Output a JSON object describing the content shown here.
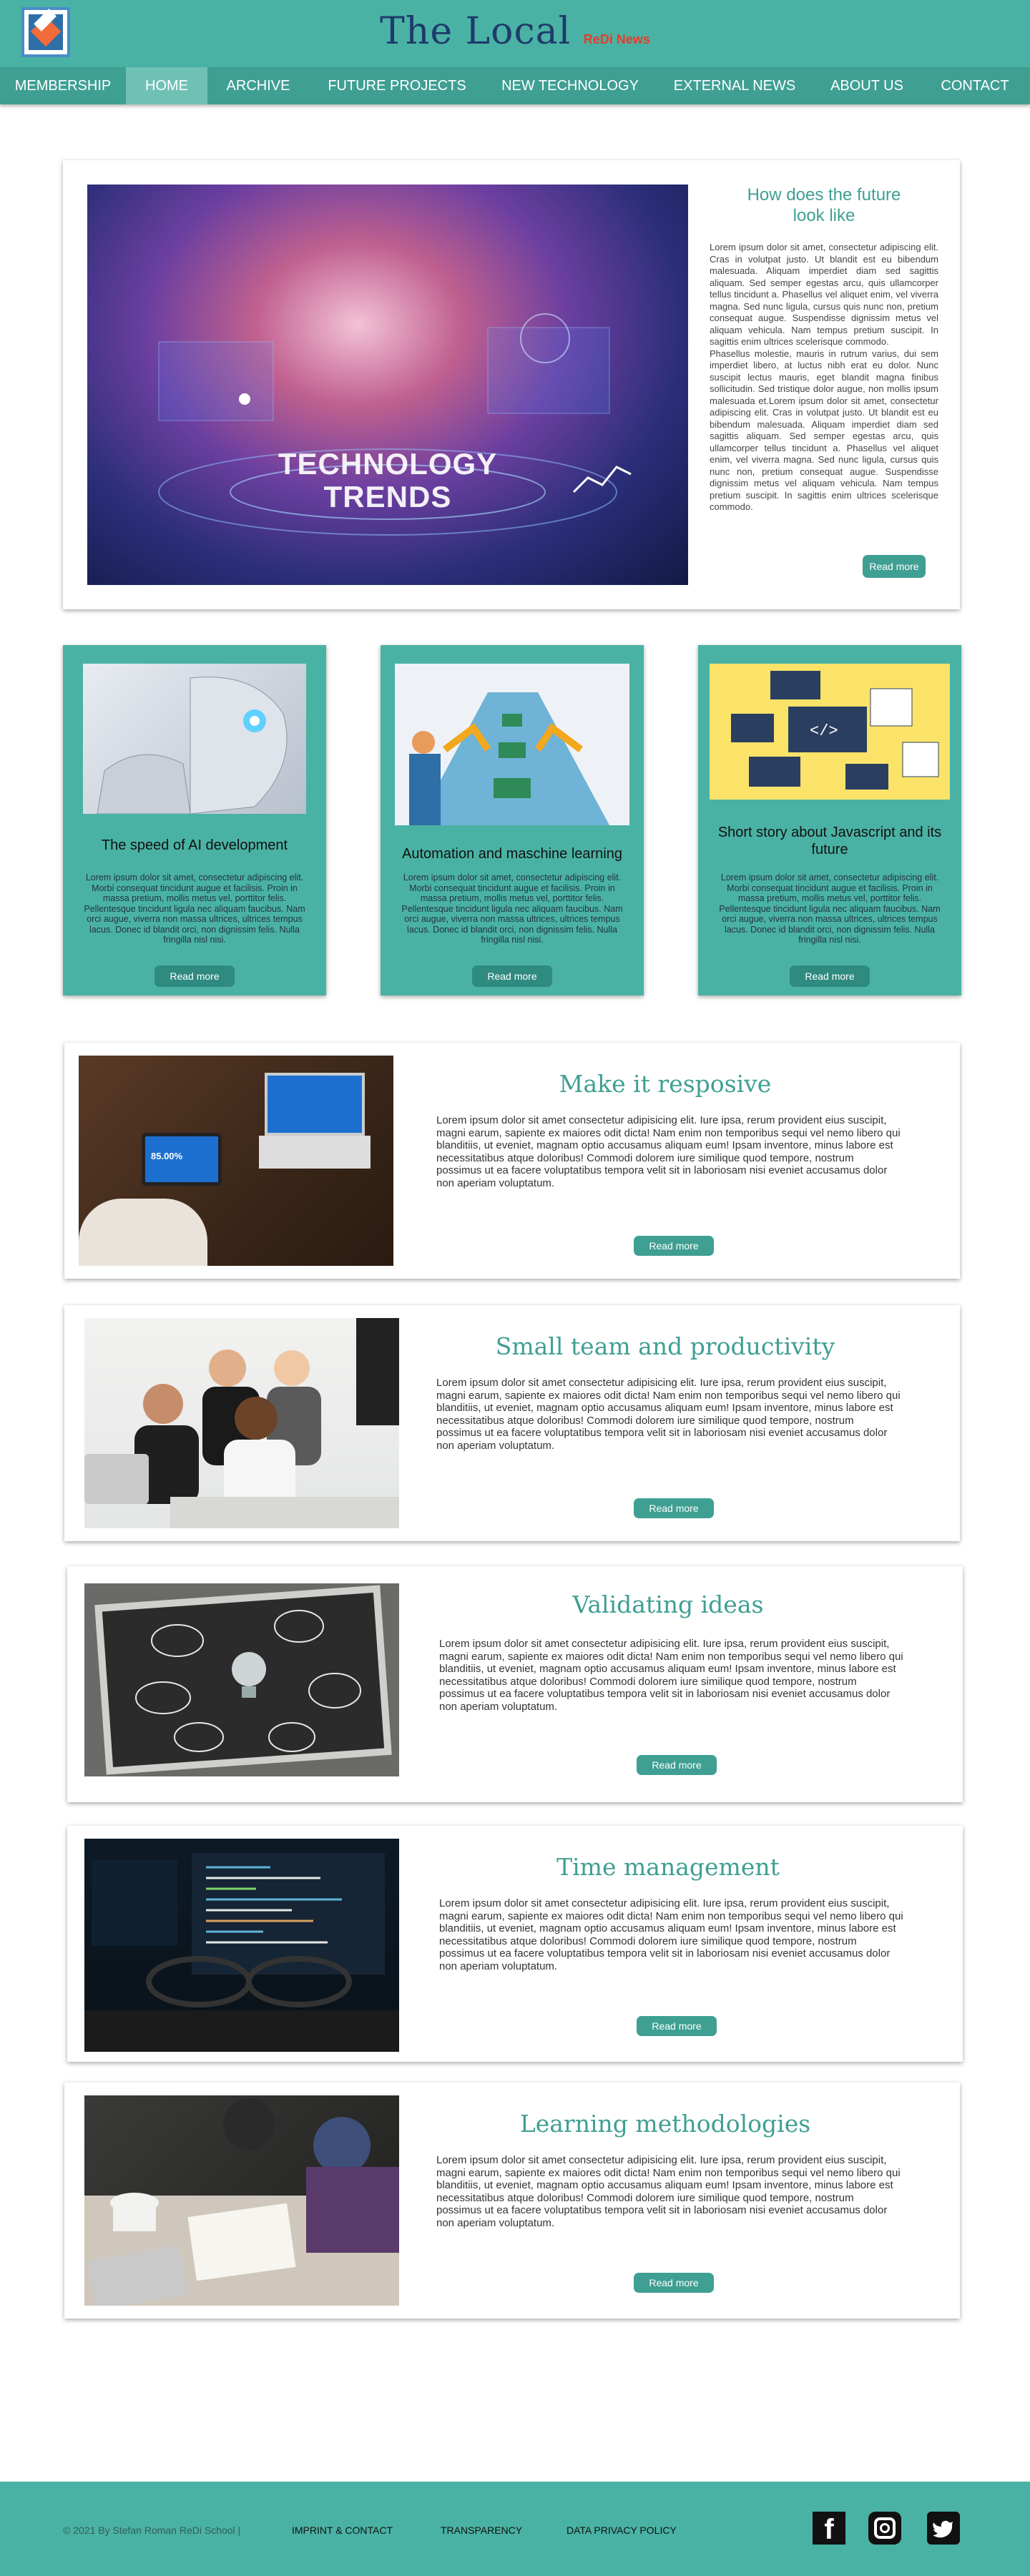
{
  "header": {
    "title": "The Local",
    "subtitle": "ReDi News"
  },
  "nav": {
    "items": [
      {
        "label": "MEMBERSHIP"
      },
      {
        "label": "HOME"
      },
      {
        "label": "ARCHIVE"
      },
      {
        "label": "FUTURE PROJECTS"
      },
      {
        "label": "NEW TECHNOLOGY"
      },
      {
        "label": "EXTERNAL NEWS"
      },
      {
        "label": "ABOUT US"
      },
      {
        "label": "CONTACT"
      }
    ],
    "active": "HOME"
  },
  "hero": {
    "image_text_line1": "TECHNOLOGY",
    "image_text_line2": "TRENDS",
    "title": "How does the future look like",
    "body1": "Lorem ipsum dolor sit amet, consectetur adipiscing elit. Cras in volutpat justo. Ut blandit est eu bibendum malesuada. Aliquam imperdiet diam sed sagittis aliquam. Sed semper egestas arcu, quis ullamcorper tellus tincidunt a. Phasellus vel aliquet enim, vel viverra magna. Sed nunc ligula, cursus quis nunc non, pretium consequat augue. Suspendisse dignissim metus vel aliquam vehicula. Nam tempus pretium suscipit. In sagittis enim ultrices scelerisque commodo.",
    "body2": "Phasellus molestie, mauris in rutrum varius, dui sem imperdiet libero, at luctus nibh erat eu dolor. Nunc suscipit lectus mauris, eget blandit magna finibus sollicitudin. Sed tristique dolor augue, non mollis ipsum malesuada et.Lorem ipsum dolor sit amet, consectetur adipiscing elit. Cras in volutpat justo. Ut blandit est eu bibendum malesuada. Aliquam imperdiet diam sed sagittis aliquam. Sed semper egestas arcu, quis ullamcorper tellus tincidunt a. Phasellus vel aliquet enim, vel viverra magna. Sed nunc ligula, cursus quis nunc non, pretium consequat augue. Suspendisse dignissim metus vel aliquam vehicula. Nam tempus pretium suscipit. In sagittis enim ultrices scelerisque commodo.",
    "button": "Read more"
  },
  "tiles": [
    {
      "title": "The speed of AI development",
      "body": "Lorem ipsum dolor sit amet, consectetur adipiscing elit. Morbi consequat tincidunt augue et facilisis. Proin in massa pretium, mollis metus vel, porttitor felis. Pellentesque tincidunt ligula nec aliquam faucibus. Nam orci augue, viverra non massa ultrices, ultrices tempus lacus. Donec id blandit orci, non dignissim felis. Nulla fringilla nisl nisi.",
      "button": "Read more"
    },
    {
      "title": "Automation and maschine learning",
      "body": "Lorem ipsum dolor sit amet, consectetur adipiscing elit. Morbi consequat tincidunt augue et facilisis. Proin in massa pretium, mollis metus vel, porttitor felis. Pellentesque tincidunt ligula nec aliquam faucibus. Nam orci augue, viverra non massa ultrices, ultrices tempus lacus. Donec id blandit orci, non dignissim felis. Nulla fringilla nisl nisi.",
      "button": "Read more"
    },
    {
      "title": "Short story about Javascript and its future",
      "body": "Lorem ipsum dolor sit amet, consectetur adipiscing elit. Morbi consequat tincidunt augue et facilisis. Proin in massa pretium, mollis metus vel, porttitor felis. Pellentesque tincidunt ligula nec aliquam faucibus. Nam orci augue, viverra non massa ultrices, ultrices tempus lacus. Donec id blandit orci, non dignissim felis. Nulla fringilla nisl nisi.",
      "button": "Read more"
    }
  ],
  "articles": [
    {
      "title": "Make it resposive",
      "body": "Lorem ipsum dolor sit amet consectetur adipisicing elit. Iure ipsa, rerum provident eius suscipit, magni earum, sapiente ex maiores odit dicta! Nam enim non temporibus sequi vel nemo libero qui blanditiis, ut eveniet, magnam optio accusamus aliquam eum! Ipsam inventore, minus labore est necessitatibus atque doloribus! Commodi dolorem iure similique quod tempore, nostrum possimus ut ea facere voluptatibus tempora velit sit in laboriosam nisi eveniet accusamus dolor non aperiam voluptatum.",
      "button": "Read more",
      "image_text": "85.00%"
    },
    {
      "title": "Small team and productivity",
      "body": "Lorem ipsum dolor sit amet consectetur adipisicing elit. Iure ipsa, rerum provident eius suscipit, magni earum, sapiente ex maiores odit dicta! Nam enim non temporibus sequi vel nemo libero qui blanditiis, ut eveniet, magnam optio accusamus aliquam eum! Ipsam inventore, minus labore est necessitatibus atque doloribus! Commodi dolorem iure similique quod tempore, nostrum possimus ut ea facere voluptatibus tempora velit sit in laboriosam nisi eveniet accusamus dolor non aperiam voluptatum.",
      "button": "Read more"
    },
    {
      "title": "Validating ideas",
      "body": "Lorem ipsum dolor sit amet consectetur adipisicing elit. Iure ipsa, rerum provident eius suscipit, magni earum, sapiente ex maiores odit dicta! Nam enim non temporibus sequi vel nemo libero qui blanditiis, ut eveniet, magnam optio accusamus aliquam eum! Ipsam inventore, minus labore est necessitatibus atque doloribus! Commodi dolorem iure similique quod tempore, nostrum possimus ut ea facere voluptatibus tempora velit sit in laboriosam nisi eveniet accusamus dolor non aperiam voluptatum.",
      "button": "Read more"
    },
    {
      "title": "Time management",
      "body": "Lorem ipsum dolor sit amet consectetur adipisicing elit. Iure ipsa, rerum provident eius suscipit, magni earum, sapiente ex maiores odit dicta! Nam enim non temporibus sequi vel nemo libero qui blanditiis, ut eveniet, magnam optio accusamus aliquam eum! Ipsam inventore, minus labore est necessitatibus atque doloribus! Commodi dolorem iure similique quod tempore, nostrum possimus ut ea facere voluptatibus tempora velit sit in laboriosam nisi eveniet accusamus dolor non aperiam voluptatum.",
      "button": "Read more"
    },
    {
      "title": "Learning methodologies",
      "body": "Lorem ipsum dolor sit amet consectetur adipisicing elit. Iure ipsa, rerum provident eius suscipit, magni earum, sapiente ex maiores odit dicta! Nam enim non temporibus sequi vel nemo libero qui blanditiis, ut eveniet, magnam optio accusamus aliquam eum! Ipsam inventore, minus labore est necessitatibus atque doloribus! Commodi dolorem iure similique quod tempore, nostrum possimus ut ea facere voluptatibus tempora velit sit in laboriosam nisi eveniet accusamus dolor non aperiam voluptatum.",
      "button": "Read more"
    }
  ],
  "footer": {
    "copyright": "© 2021 By Stefan Roman ReDi School |",
    "links": [
      "IMPRINT & CONTACT",
      "TRANSPARENCY",
      "DATA PRIVACY POLICY"
    ],
    "social": {
      "facebook": "f",
      "instagram": "instagram-icon",
      "twitter": "twitter-icon"
    }
  },
  "colors": {
    "accent": "#4ab2a4",
    "nav": "#3f9f93",
    "title": "#1f3a6a",
    "subtitle": "#e53d2a"
  }
}
